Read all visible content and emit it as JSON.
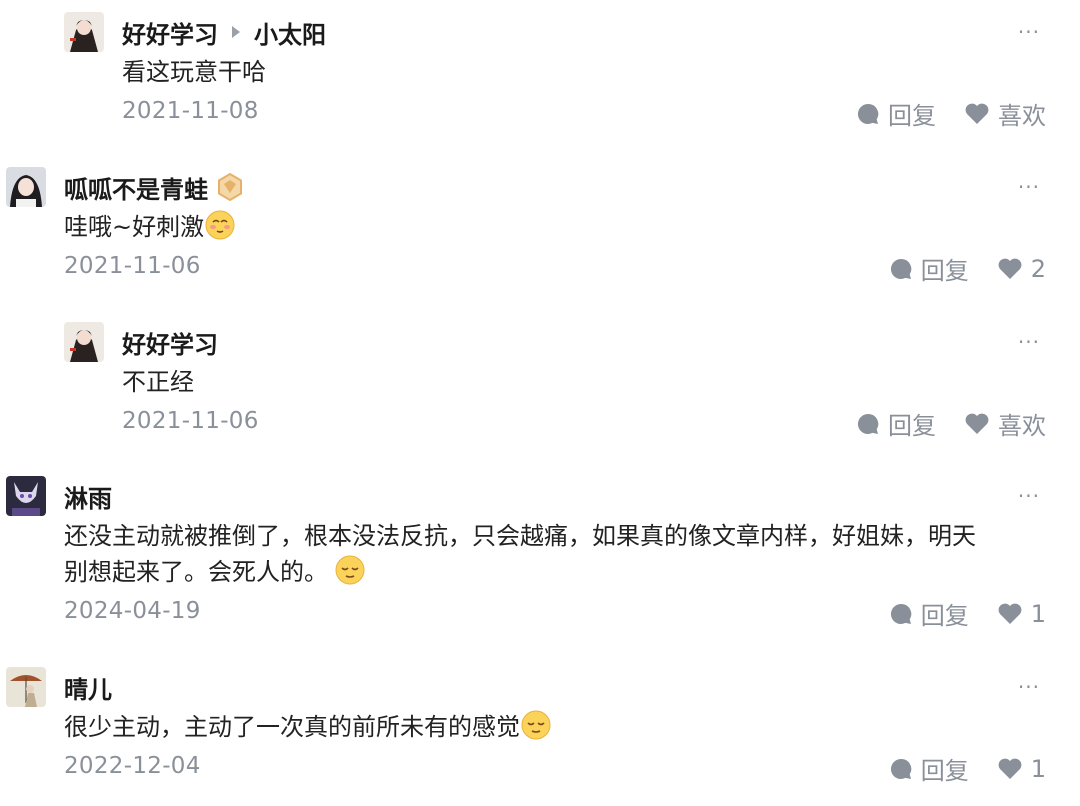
{
  "comments": [
    {
      "author": "好好学习",
      "reply_to": "小太阳",
      "text": "看这玩意干哈",
      "date": "2021-11-08",
      "reply_label": "回复",
      "like_label": "喜欢",
      "more": "···"
    },
    {
      "author": "呱呱不是青蛙",
      "badge_icon": "level-badge-icon",
      "text": "哇哦~好刺激",
      "text_emoji": "blush-emoji-icon",
      "date": "2021-11-06",
      "reply_label": "回复",
      "likes": "2",
      "more": "···"
    },
    {
      "author": "好好学习",
      "text": "不正经",
      "date": "2021-11-06",
      "reply_label": "回复",
      "like_label": "喜欢",
      "more": "···"
    },
    {
      "author": "淋雨",
      "text_line1": "还没主动就被推倒了，根本没法反抗，只会越痛，如果真的像文章内样，好姐妹，明天",
      "text_line2": "别想起来了。会死人的。",
      "text_emoji": "relieved-emoji-icon",
      "date": "2024-04-19",
      "reply_label": "回复",
      "likes": "1",
      "more": "···"
    },
    {
      "author": "晴儿",
      "text": "很少主动，主动了一次真的前所未有的感觉",
      "text_emoji": "relieved-emoji-icon",
      "date": "2022-12-04",
      "reply_label": "回复",
      "likes": "1",
      "more": "···"
    }
  ],
  "colors": {
    "meta_gray": "#8a9099",
    "text": "#222222",
    "name": "#1a1a1a",
    "badge": "#e6b26a"
  }
}
